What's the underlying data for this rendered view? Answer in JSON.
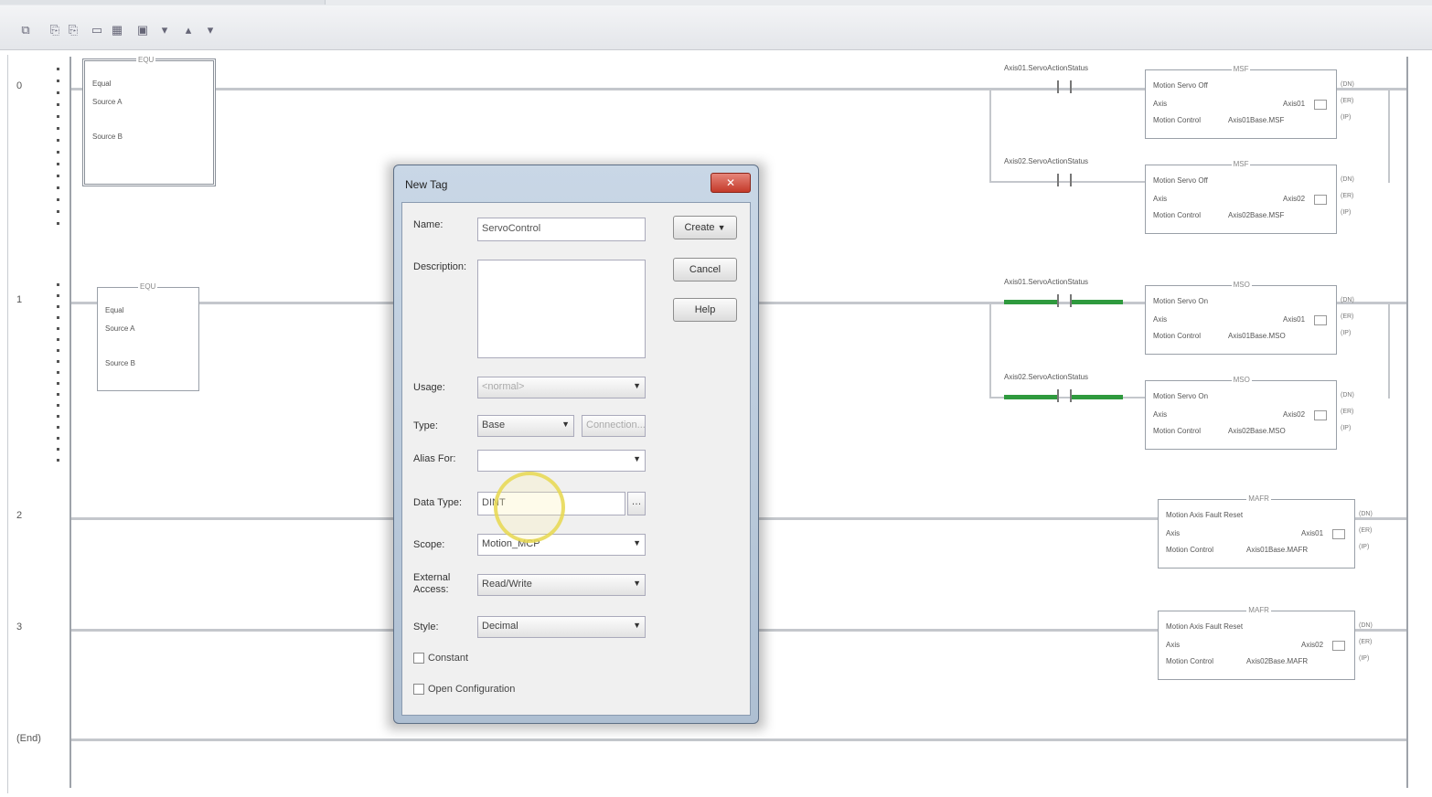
{
  "toolbar": {
    "icons": [
      "cut-icon",
      "copy-icon",
      "paste-icon",
      "delete-icon",
      "undo-icon",
      "save-icon",
      "dropdown-icon",
      "move-up-icon",
      "move-down-icon"
    ],
    "glyphs": [
      "⧉",
      "⎘",
      "⎘",
      "▭",
      "▦",
      "▣",
      "▾",
      "▴",
      "▾"
    ]
  },
  "ladder": {
    "rungs": [
      {
        "number": "0"
      },
      {
        "number": "1"
      },
      {
        "number": "2"
      },
      {
        "number": "3"
      },
      {
        "number": "(End)"
      }
    ],
    "left_blocks": [
      {
        "title": "EQU",
        "line1": "Equal",
        "line2": "Source A",
        "line3": "Source B"
      },
      {
        "title": "EQU",
        "line1": "Equal",
        "line2": "Source A",
        "line3": "Source B"
      }
    ],
    "contacts": [
      {
        "label": "Axis01.ServoActionStatus",
        "energized": false
      },
      {
        "label": "Axis02.ServoActionStatus",
        "energized": false
      },
      {
        "label": "Axis01.ServoActionStatus",
        "energized": true
      },
      {
        "label": "Axis02.ServoActionStatus",
        "energized": true
      }
    ],
    "instructions": [
      {
        "title": "MSF",
        "line1": "Motion Servo Off",
        "line2": "Axis",
        "line3": "Motion Control",
        "axis": "Axis01",
        "tag": "Axis01Base.MSF"
      },
      {
        "title": "MSF",
        "line1": "Motion Servo Off",
        "line2": "Axis",
        "line3": "Motion Control",
        "axis": "Axis02",
        "tag": "Axis02Base.MSF"
      },
      {
        "title": "MSO",
        "line1": "Motion Servo On",
        "line2": "Axis",
        "line3": "Motion Control",
        "axis": "Axis01",
        "tag": "Axis01Base.MSO"
      },
      {
        "title": "MSO",
        "line1": "Motion Servo On",
        "line2": "Axis",
        "line3": "Motion Control",
        "axis": "Axis02",
        "tag": "Axis02Base.MSO"
      },
      {
        "title": "MAFR",
        "line1": "Motion Axis Fault Reset",
        "line2": "Axis",
        "line3": "Motion Control",
        "axis": "Axis01",
        "tag": "Axis01Base.MAFR"
      },
      {
        "title": "MAFR",
        "line1": "Motion Axis Fault Reset",
        "line2": "Axis",
        "line3": "Motion Control",
        "axis": "Axis02",
        "tag": "Axis02Base.MAFR"
      }
    ],
    "output_flags": [
      "(DN)",
      "(ER)",
      "(IP)"
    ]
  },
  "dialog": {
    "title": "New Tag",
    "close_label": "✕",
    "name_label": "Name:",
    "name_value": "ServoControl",
    "description_label": "Description:",
    "description_value": "",
    "usage_label": "Usage:",
    "usage_value": "<normal>",
    "type_label": "Type:",
    "type_value": "Base",
    "connection_button": "Connection...",
    "alias_label": "Alias For:",
    "alias_value": "",
    "datatype_label": "Data Type:",
    "datatype_value": "DINT",
    "scope_label": "Scope:",
    "scope_value": "Motion_MCP",
    "external_access_label": "External Access:",
    "external_access_value": "Read/Write",
    "style_label": "Style:",
    "style_value": "Decimal",
    "constant_label": "Constant",
    "open_config_label": "Open Configuration",
    "create_button": "Create",
    "cancel_button": "Cancel",
    "help_button": "Help"
  }
}
